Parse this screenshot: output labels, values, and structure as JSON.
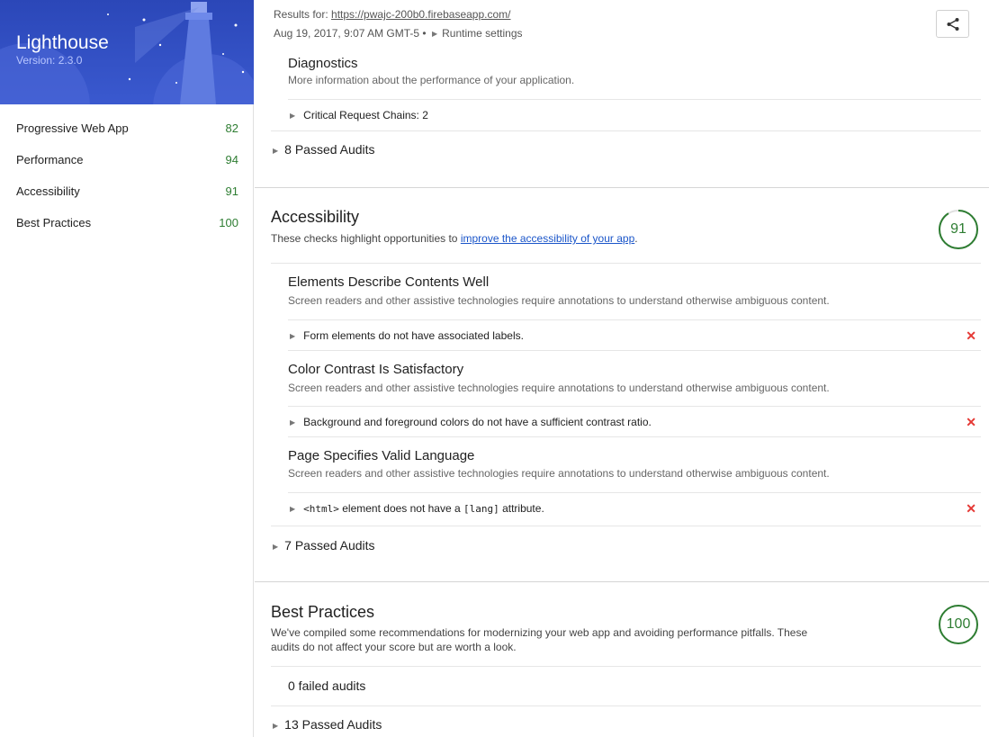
{
  "app": {
    "title": "Lighthouse",
    "version": "Version: 2.3.0"
  },
  "sidebar": {
    "categories": [
      {
        "label": "Progressive Web App",
        "score": "82"
      },
      {
        "label": "Performance",
        "score": "94"
      },
      {
        "label": "Accessibility",
        "score": "91"
      },
      {
        "label": "Best Practices",
        "score": "100"
      }
    ]
  },
  "header": {
    "results_prefix": "Results for:",
    "url": "https://pwajc-200b0.firebaseapp.com/",
    "date": "Aug 19, 2017, 9:07 AM GMT-5 •",
    "runtime_settings": "Runtime settings"
  },
  "performance": {
    "diagnostics_title": "Diagnostics",
    "diagnostics_desc": "More information about the performance of your application.",
    "critical_chains": "Critical Request Chains: 2",
    "passed": "8 Passed Audits"
  },
  "accessibility": {
    "title": "Accessibility",
    "desc_prefix": "These checks highlight opportunities to",
    "desc_link": "improve the accessibility of your app",
    "desc_suffix": ".",
    "score": "91",
    "groups": [
      {
        "title": "Elements Describe Contents Well",
        "desc": "Screen readers and other assistive technologies require annotations to understand otherwise ambiguous content.",
        "audit": "Form elements do not have associated labels."
      },
      {
        "title": "Color Contrast Is Satisfactory",
        "desc": "Screen readers and other assistive technologies require annotations to understand otherwise ambiguous content.",
        "audit": "Background and foreground colors do not have a sufficient contrast ratio."
      },
      {
        "title": "Page Specifies Valid Language",
        "desc": "Screen readers and other assistive technologies require annotations to understand otherwise ambiguous content.",
        "audit_code1": "<html>",
        "audit_mid": " element does not have a ",
        "audit_code2": "[lang]",
        "audit_end": " attribute."
      }
    ],
    "fail_mark": "✕",
    "passed": "7 Passed Audits"
  },
  "best_practices": {
    "title": "Best Practices",
    "desc_line1": "We've compiled some recommendations for modernizing your web app and avoiding performance pitfalls. These",
    "desc_line2": "audits do not affect your score but are worth a look.",
    "score": "100",
    "failed": "0 failed audits",
    "passed": "13 Passed Audits"
  },
  "colors": {
    "banner": "#3a59cf",
    "score_green": "#2e7d32",
    "fail_red": "#e53935",
    "link_blue": "#1a55c9"
  },
  "icons": {
    "share": "share-icon",
    "expand": "triangle-right-icon",
    "fail": "close-icon"
  }
}
